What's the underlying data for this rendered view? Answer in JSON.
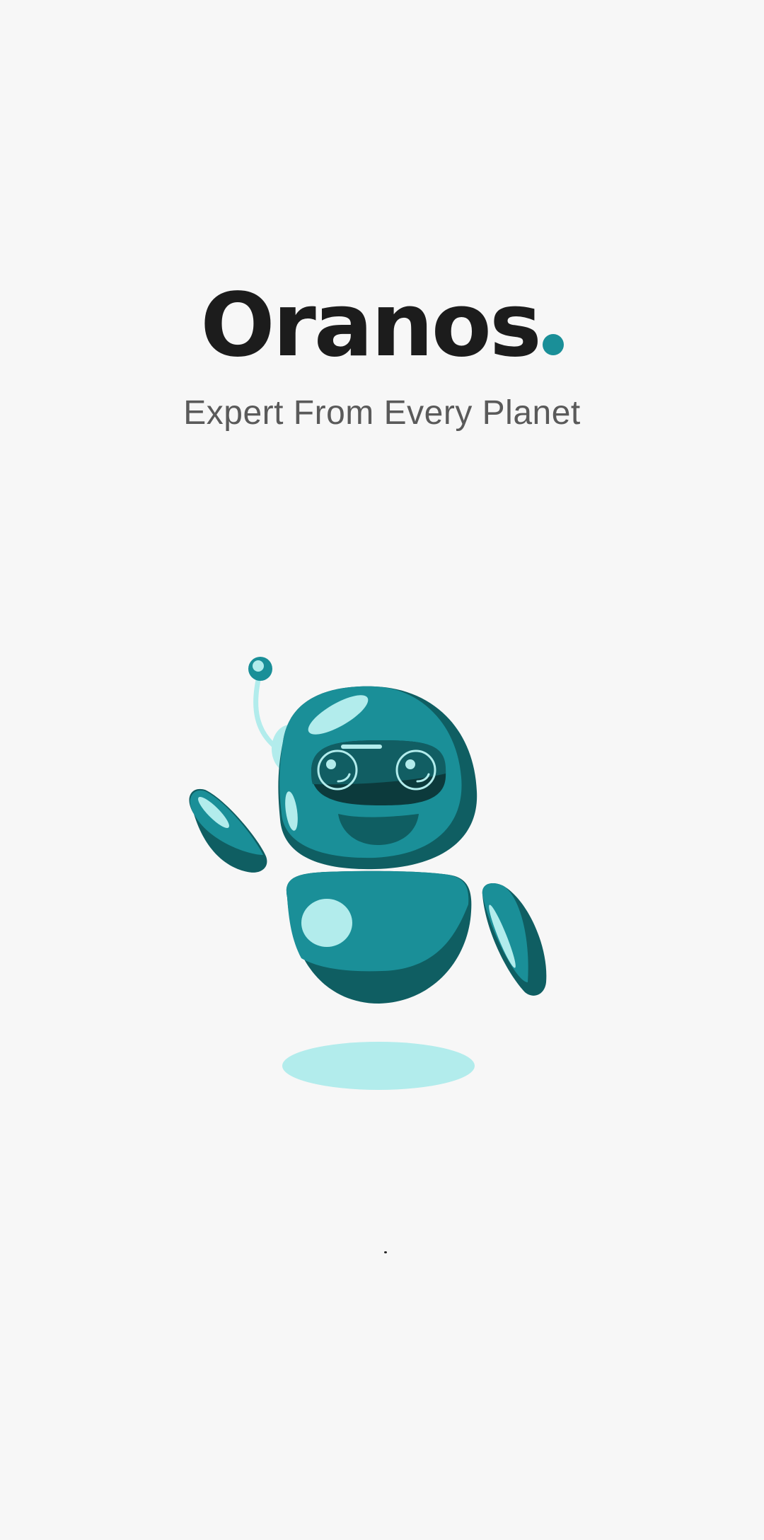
{
  "brand": {
    "name": "Oranos",
    "dot_color": "#1a8f98",
    "tagline": "Expert From Every Planet"
  },
  "mascot": {
    "icon": "robot-mascot-icon",
    "primary_color": "#1a8f98",
    "shade_color": "#0f5e62",
    "highlight_color": "#b2ecec"
  },
  "loader": {
    "icon": "loading-indicator"
  }
}
